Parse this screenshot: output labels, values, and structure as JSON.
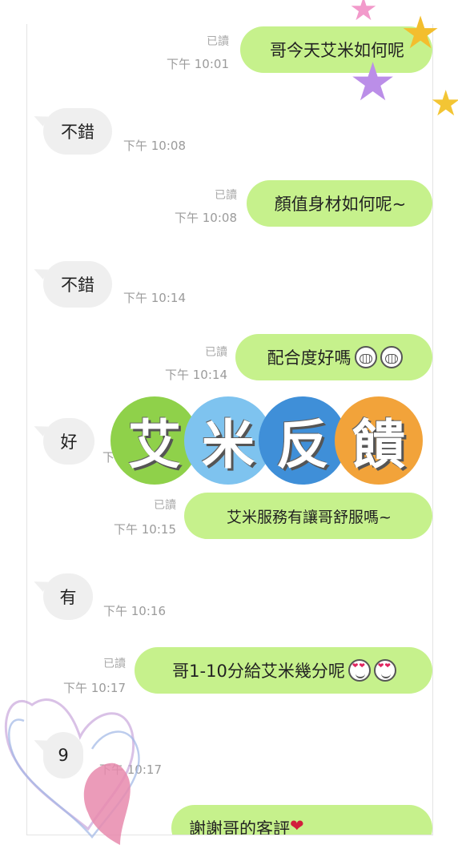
{
  "messages": [
    {
      "dir": "out",
      "text": "哥今天艾米如何呢",
      "read": "已讀",
      "time": "下午 10:01"
    },
    {
      "dir": "in",
      "text": "不錯",
      "time": "下午 10:08"
    },
    {
      "dir": "out",
      "text": "顏值身材如何呢~",
      "read": "已讀",
      "time": "下午 10:08"
    },
    {
      "dir": "in",
      "text": "不錯",
      "time": "下午 10:14"
    },
    {
      "dir": "out",
      "text": "配合度好嗎",
      "read": "已讀",
      "time": "下午 10:14"
    },
    {
      "dir": "in",
      "text": "好",
      "time": "下午 10:15"
    },
    {
      "dir": "out",
      "text": "艾米服務有讓哥舒服嗎~",
      "read": "已讀",
      "time": "下午 10:15"
    },
    {
      "dir": "in",
      "text": "有",
      "time": "下午 10:16"
    },
    {
      "dir": "out",
      "text": "哥1-10分給艾米幾分呢",
      "read": "已讀",
      "time": "下午 10:17"
    },
    {
      "dir": "in",
      "text": "9",
      "time": "下午 10:17"
    },
    {
      "dir": "out",
      "text": "謝謝哥的客評"
    }
  ],
  "banner": {
    "chars": [
      "艾",
      "米",
      "反",
      "饋"
    ],
    "colors": [
      "#8fd14a",
      "#7ec3ef",
      "#3f8fd8",
      "#f2a33a"
    ]
  },
  "emojis": {
    "msg5": "grimace-emoji",
    "msg9": "heart-eyes-emoji",
    "msg11": "heart"
  },
  "colors": {
    "outgoing_bubble": "#c6f18c",
    "incoming_bubble": "#efefef"
  }
}
